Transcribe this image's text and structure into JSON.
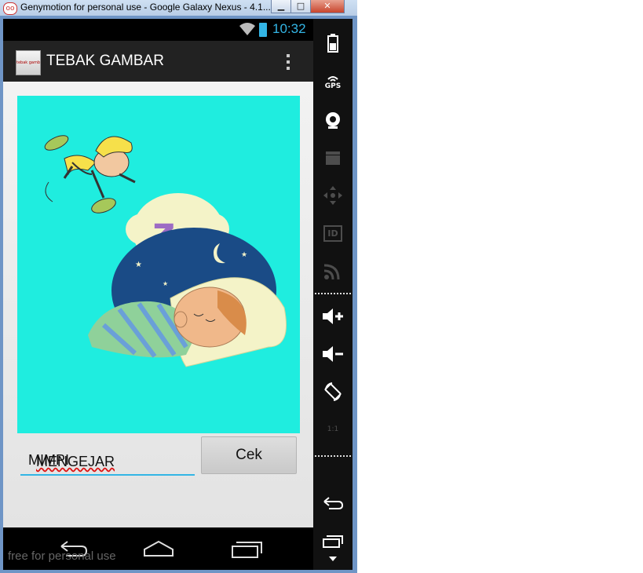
{
  "window": {
    "title": "Genymotion for personal use - Google Galaxy Nexus - 4.1...",
    "icon_label": "oo",
    "buttons": {
      "minimize": "▁",
      "maximize": "□",
      "close": "✕"
    }
  },
  "status_bar": {
    "time": "10:32",
    "icons": [
      "wifi-icon",
      "battery-charging-icon"
    ]
  },
  "action_bar": {
    "title": "TEBAK GAMBAR",
    "logo_text": "tebak gambar",
    "menu_icon": "overflow-menu-icon"
  },
  "main": {
    "picture": {
      "icon": "z",
      "description_icon": "sleeping-boy-dream-illustration"
    },
    "answer_input": {
      "value_misspelled": "MENGEJAR",
      "value_rest": " MIMPI"
    },
    "check_button": {
      "label": "Cek"
    }
  },
  "nav_bar": {
    "icons": [
      "back-icon",
      "home-icon",
      "recent-apps-icon"
    ]
  },
  "watermark": "free for personal use",
  "side_toolbar": {
    "gps_label": "GPS",
    "id_label": "ID",
    "scale_label": "1:1",
    "icons": [
      "battery-icon",
      "gps-icon",
      "camera-icon",
      "video-icon",
      "dpad-icon",
      "id-icon",
      "cast-icon",
      "volume-up-icon",
      "volume-down-icon",
      "rotate-icon",
      "scale-icon",
      "back-icon",
      "recent-apps-icon",
      "more-icon"
    ]
  },
  "colors": {
    "accent": "#33b5e5",
    "picture_bg": "#1feddf",
    "action_bar": "#222222"
  }
}
